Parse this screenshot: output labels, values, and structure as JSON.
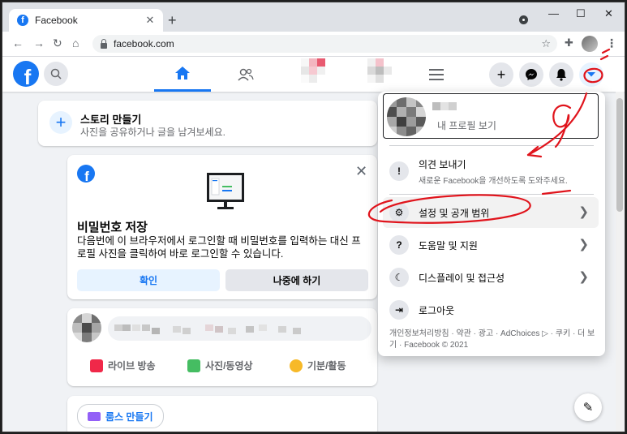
{
  "browser": {
    "tab_title": "Facebook",
    "url": "facebook.com",
    "new_tab": "+",
    "tab_close": "✕",
    "window_controls": [
      "—",
      "☐",
      "✕"
    ]
  },
  "fb_header": {
    "logo_letter": "f",
    "icons": [
      "search-icon",
      "home-icon",
      "friends-icon",
      "menu-icon",
      "create-icon",
      "messenger-icon",
      "notifications-icon",
      "account-dropdown-icon"
    ]
  },
  "story": {
    "title": "스토리 만들기",
    "subtitle": "사진을 공유하거나 글을 남겨보세요."
  },
  "password_card": {
    "title": "비밀번호 저장",
    "description": "다음번에 이 브라우저에서 로그인할 때 비밀번호를 입력하는 대신 프로필 사진을 클릭하여 바로 로그인할 수 있습니다.",
    "confirm_label": "확인",
    "later_label": "나중에 하기"
  },
  "composer": {
    "actions": [
      {
        "label": "라이브 방송",
        "color": "#f02849"
      },
      {
        "label": "사진/동영상",
        "color": "#45bd62"
      },
      {
        "label": "기분/활동",
        "color": "#f7b928"
      }
    ]
  },
  "rooms": {
    "label": "룸스 만들기"
  },
  "menu": {
    "profile_link": "내 프로필 보기",
    "feedback_title": "의견 보내기",
    "feedback_sub": "새로운 Facebook을 개선하도록 도와주세요.",
    "items": [
      {
        "label": "설정 및 공개 범위",
        "icon": "gear-icon"
      },
      {
        "label": "도움말 및 지원",
        "icon": "question-icon"
      },
      {
        "label": "디스플레이 및 접근성",
        "icon": "moon-icon"
      },
      {
        "label": "로그아웃",
        "icon": "logout-icon"
      }
    ],
    "footer": "개인정보처리방침 · 약관 · 광고 · AdChoices ▷ · 쿠키 · 더 보기 · Facebook © 2021"
  },
  "colors": {
    "brand": "#1877f2",
    "annotation_red": "#e0141c"
  }
}
